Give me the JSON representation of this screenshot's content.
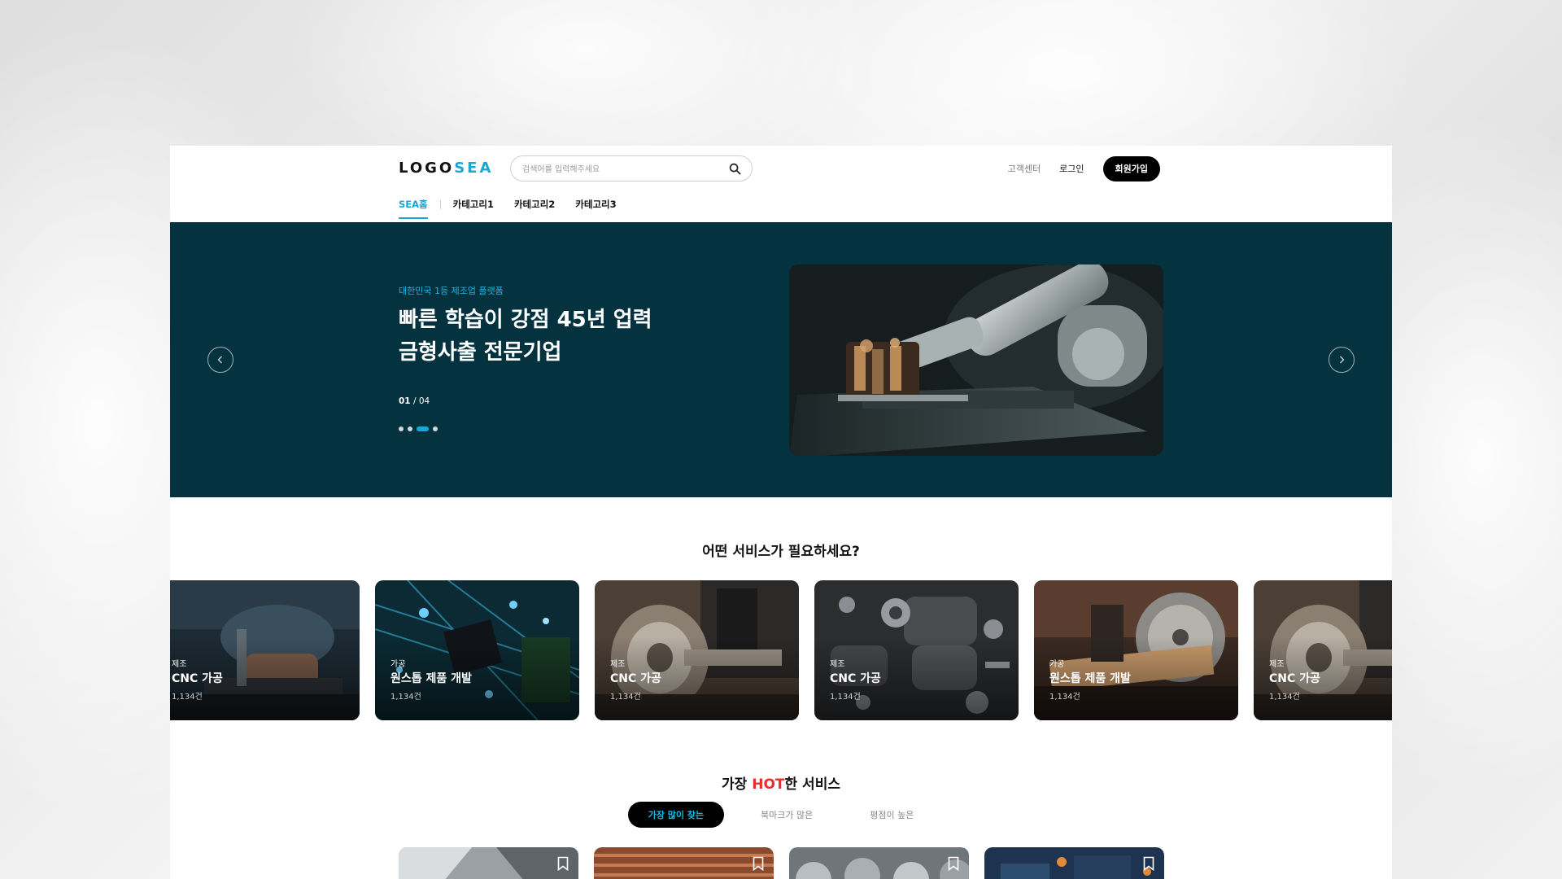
{
  "header": {
    "logo_main": "LOGO",
    "logo_accent": "SEA",
    "search_placeholder": "검색어를 입력해주세요",
    "customer_center": "고객센터",
    "login": "로그인",
    "signup": "회원가입"
  },
  "nav": {
    "tabs": [
      {
        "label": "SEA홈",
        "active": true
      },
      {
        "label": "카테고리1",
        "active": false
      },
      {
        "label": "카테고리2",
        "active": false
      },
      {
        "label": "카테고리3",
        "active": false
      }
    ]
  },
  "hero": {
    "eyebrow": "대한민국 1등 제조업 플랫폼",
    "headline_line1": "빠른 학습이 강점 45년 업력",
    "headline_line2": "금형사출 전문기업",
    "page_current": "01",
    "page_total": "/ 04",
    "slide_count": 4,
    "active_dot": 3,
    "background": "#04323f",
    "accent": "#19a7d6"
  },
  "services": {
    "title": "어떤 서비스가 필요하세요?",
    "cards": [
      {
        "category": "제조",
        "name": "CNC 가공",
        "count": "1,134건",
        "image": "machinist-hands"
      },
      {
        "category": "가공",
        "name": "원스톱 제품 개발",
        "count": "1,134건",
        "image": "circuit-board"
      },
      {
        "category": "제조",
        "name": "CNC 가공",
        "count": "1,134건",
        "image": "lathe-chuck"
      },
      {
        "category": "제조",
        "name": "CNC 가공",
        "count": "1,134건",
        "image": "brake-pads-parts"
      },
      {
        "category": "가공",
        "name": "원스톱 제품 개발",
        "count": "1,134건",
        "image": "wood-saw"
      },
      {
        "category": "제조",
        "name": "CNC 가공",
        "count": "1,134건",
        "image": "lathe-chuck"
      }
    ]
  },
  "hot": {
    "title_pre": "가장 ",
    "title_hot": "HOT",
    "title_post": "한 서비스",
    "hot_color": "#e8302a",
    "filters": [
      {
        "label": "가장 많이 찾는",
        "active": true
      },
      {
        "label": "북마크가 많은",
        "active": false
      },
      {
        "label": "평점이 높은",
        "active": false
      }
    ],
    "products": [
      {
        "image": "steel-sheet",
        "bookmark_icon": "bookmark-icon"
      },
      {
        "image": "copper-coils",
        "bookmark_icon": "bookmark-icon"
      },
      {
        "image": "metal-fittings",
        "bookmark_icon": "bookmark-icon"
      },
      {
        "image": "electronics-board",
        "bookmark_icon": "bookmark-icon"
      }
    ]
  }
}
